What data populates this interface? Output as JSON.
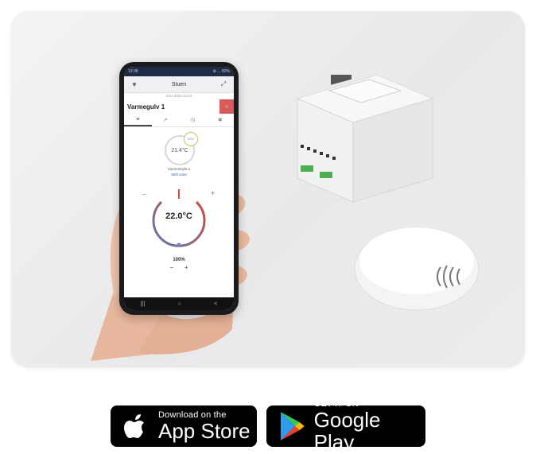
{
  "phone": {
    "status_left": "13:38",
    "status_right": "⚙ ... 82%",
    "topbar_title": "Stuen",
    "datetime": "22/1 2023 13:23",
    "device_name": "Varmegulv 1",
    "room_temp": "21.4°C",
    "eco_badge": "ECO",
    "room_label": "Varmesloyfe 1",
    "room_link": "Skift sone",
    "target_temp": "22.0°C",
    "bottom_value": "100%",
    "minus_label": "−",
    "plus_label": "+",
    "nav_items": [
      "|||",
      "○",
      "<"
    ]
  },
  "badges": {
    "appstore_small": "Download on the",
    "appstore_big": "App Store",
    "googleplay_small": "GET IT ON",
    "googleplay_big": "Google Play"
  },
  "colors": {
    "badge_bg": "#000000",
    "accent_red": "#d85a5a",
    "gauge_warm": "#d24a3c",
    "gauge_cool": "#5a78b5"
  },
  "icons": {
    "appstore": "apple-logo-icon",
    "googleplay": "play-triangle-icon"
  }
}
